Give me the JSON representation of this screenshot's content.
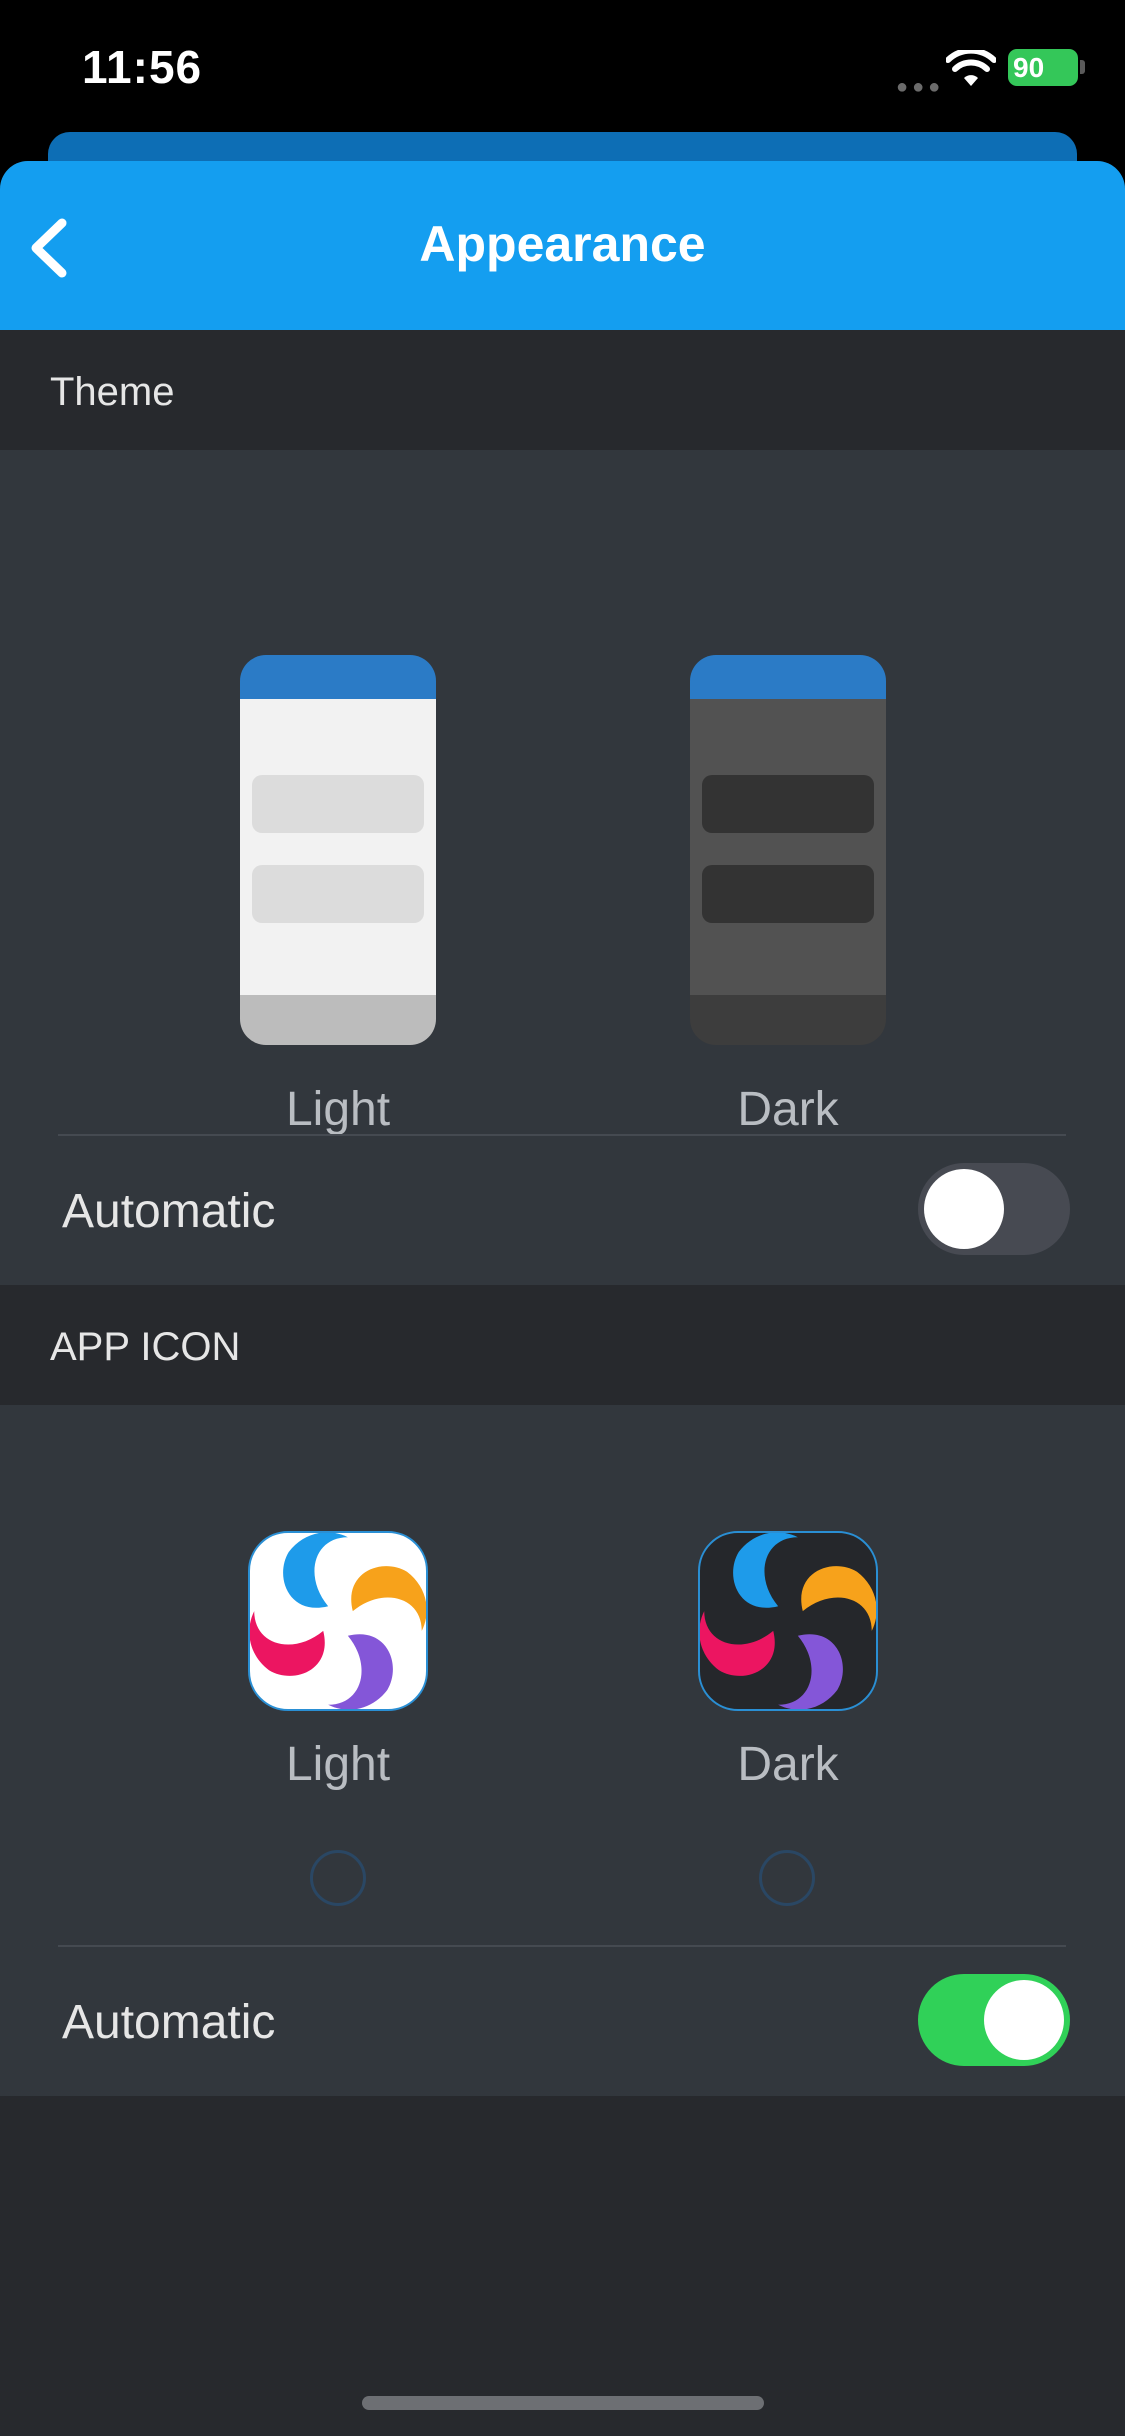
{
  "status_bar": {
    "time": "11:56",
    "battery": "90"
  },
  "nav": {
    "title": "Appearance",
    "back_icon": "chevron-left-icon"
  },
  "theme": {
    "header": "Theme",
    "options": [
      {
        "label": "Light",
        "selected": false
      },
      {
        "label": "Dark",
        "selected": true
      }
    ],
    "automatic_label": "Automatic",
    "automatic_on": false
  },
  "app_icon": {
    "header": "APP ICON",
    "options": [
      {
        "label": "Light",
        "selected": false
      },
      {
        "label": "Dark",
        "selected": false
      }
    ],
    "automatic_label": "Automatic",
    "automatic_on": true
  },
  "colors": {
    "nav_blue": "#149ef0",
    "selected_radio": "#4a88dd",
    "toggle_on": "#30d158",
    "logo_blue": "#1e9bea",
    "logo_orange": "#f7a21b",
    "logo_purple": "#8456d8",
    "logo_pink": "#ec1561"
  }
}
